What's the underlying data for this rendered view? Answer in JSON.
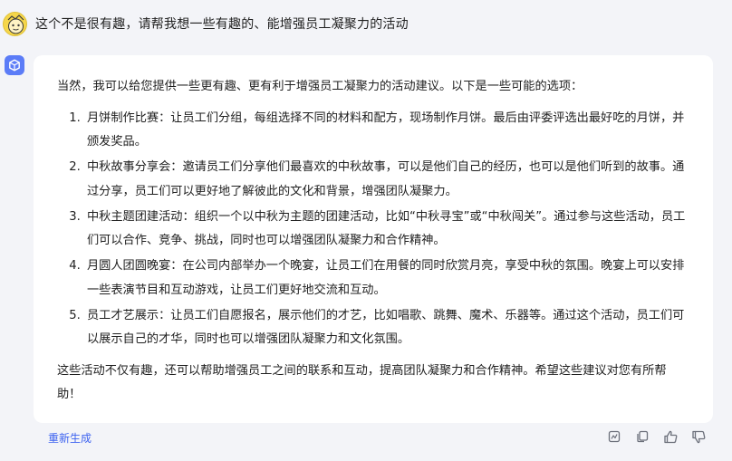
{
  "conversation": {
    "user_message": "这个不是很有趣，请帮我想一些有趣的、能增强员工凝聚力的活动",
    "answer": {
      "intro": "当然，我可以给您提供一些更有趣、更有利于增强员工凝聚力的活动建议。以下是一些可能的选项：",
      "items": [
        "月饼制作比赛：让员工们分组，每组选择不同的材料和配方，现场制作月饼。最后由评委评选出最好吃的月饼，并颁发奖品。",
        "中秋故事分享会：邀请员工们分享他们最喜欢的中秋故事，可以是他们自己的经历，也可以是他们听到的故事。通过分享，员工们可以更好地了解彼此的文化和背景，增强团队凝聚力。",
        "中秋主题团建活动：组织一个以中秋为主题的团建活动，比如“中秋寻宝”或“中秋闯关”。通过参与这些活动，员工们可以合作、竞争、挑战，同时也可以增强团队凝聚力和合作精神。",
        "月圆人团圆晚宴：在公司内部举办一个晚宴，让员工们在用餐的同时欣赏月亮，享受中秋的氛围。晚宴上可以安排一些表演节目和互动游戏，让员工们更好地交流和互动。",
        "员工才艺展示：让员工们自愿报名，展示他们的才艺，比如唱歌、跳舞、魔术、乐器等。通过这个活动，员工们可以展示自己的才华，同时也可以增强团队凝聚力和文化氛围。"
      ],
      "outro": "这些活动不仅有趣，还可以帮助增强员工之间的联系和互动，提高团队凝聚力和合作精神。希望这些建议对您有所帮助！"
    }
  },
  "toolbar": {
    "regenerate_label": "重新生成",
    "icons": [
      "report-icon",
      "copy-icon",
      "thumbs-up-icon",
      "thumbs-down-icon"
    ]
  },
  "colors": {
    "background": "#f3f4f8",
    "card": "#ffffff",
    "accent": "#3e63f0",
    "bot_avatar": "#5b7cf7",
    "icon": "#6b6f7a"
  }
}
